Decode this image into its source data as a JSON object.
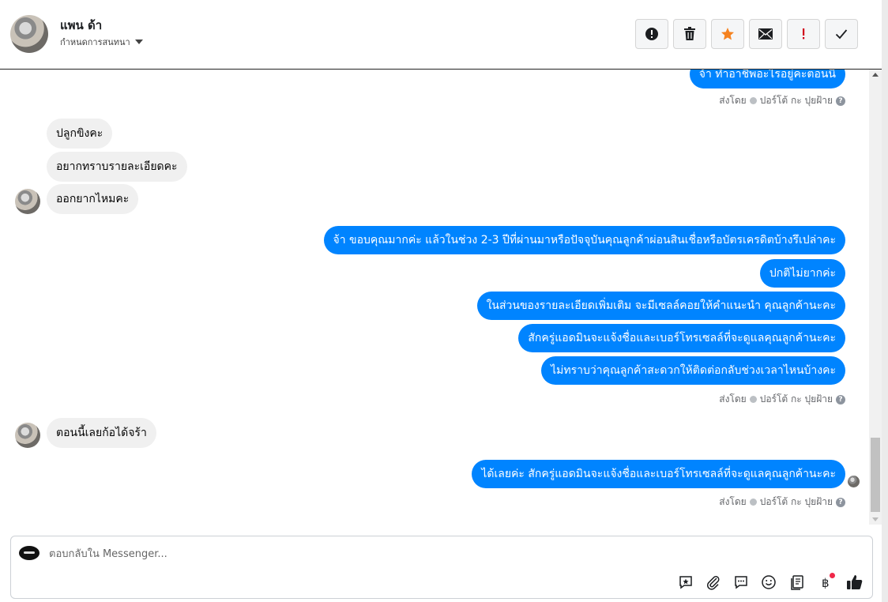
{
  "header": {
    "contact_name": "แพน ด้า",
    "subtitle": "กำหนดการสนทนา",
    "toolbar": [
      {
        "name": "spam",
        "icon": "alert-circle-icon"
      },
      {
        "name": "delete",
        "icon": "trash-icon"
      },
      {
        "name": "star",
        "icon": "star-icon",
        "color": "#f5821f"
      },
      {
        "name": "mark-unread",
        "icon": "envelope-icon"
      },
      {
        "name": "follow-up",
        "icon": "exclamation-icon",
        "color": "#d0021b"
      },
      {
        "name": "done",
        "icon": "check-icon"
      }
    ]
  },
  "messages": {
    "m1": "จ้า ทำอาชีพอะไรอยู่คะตอนนี้",
    "meta1": {
      "prefix": "ส่งโดย",
      "sender": "ปอร์โต้ กะ ปุยฝ้าย"
    },
    "in1": "ปลูกขิงคะ",
    "in2": "อยากทราบรายละเอียดคะ",
    "in3": "ออกยากไหมคะ",
    "out1": "จ้า ขอบคุณมากค่ะ  แล้วในช่วง 2-3 ปีที่ผ่านมาหรือปัจจุบันคุณลูกค้าผ่อนสินเชื่อหรือบัตรเครดิตบ้างรึเปล่าคะ",
    "out2": "ปกติไม่ยากค่ะ",
    "out3": "ในส่วนของรายละเอียดเพิ่มเติม จะมีเซลล์คอยให้คำแนะนำ คุณลูกค้านะคะ",
    "out4": "สักครู่แอดมินจะแจ้งชื่อและเบอร์โทรเซลล์ที่จะดูแลคุณลูกค้านะคะ",
    "out5": "ไม่ทราบว่าคุณลูกค้าสะดวกให้ติดต่อกลับช่วงเวลาไหนบ้างคะ",
    "meta2": {
      "prefix": "ส่งโดย",
      "sender": "ปอร์โต้ กะ ปุยฝ้าย"
    },
    "in4": "ตอนนี้เลยก้อได้จร้า",
    "out6": "ได้เลยค่ะ สักครู่แอดมินจะแจ้งชื่อและเบอร์โทรเซลล์ที่จะดูแลคุณลูกค้านะคะ",
    "meta3": {
      "prefix": "ส่งโดย",
      "sender": "ปอร์โต้ กะ ปุยฝ้าย"
    }
  },
  "composer": {
    "placeholder": "ตอบกลับใน Messenger...",
    "tools": [
      "saved-reply-icon",
      "attachment-icon",
      "chat-bubble-icon",
      "emoji-icon",
      "catalog-icon",
      "payment-icon",
      "thumbs-up-icon"
    ]
  },
  "colors": {
    "outgoing_bubble": "#0084ff",
    "incoming_bubble": "#f0f0f0",
    "like": "#1c1e21"
  }
}
